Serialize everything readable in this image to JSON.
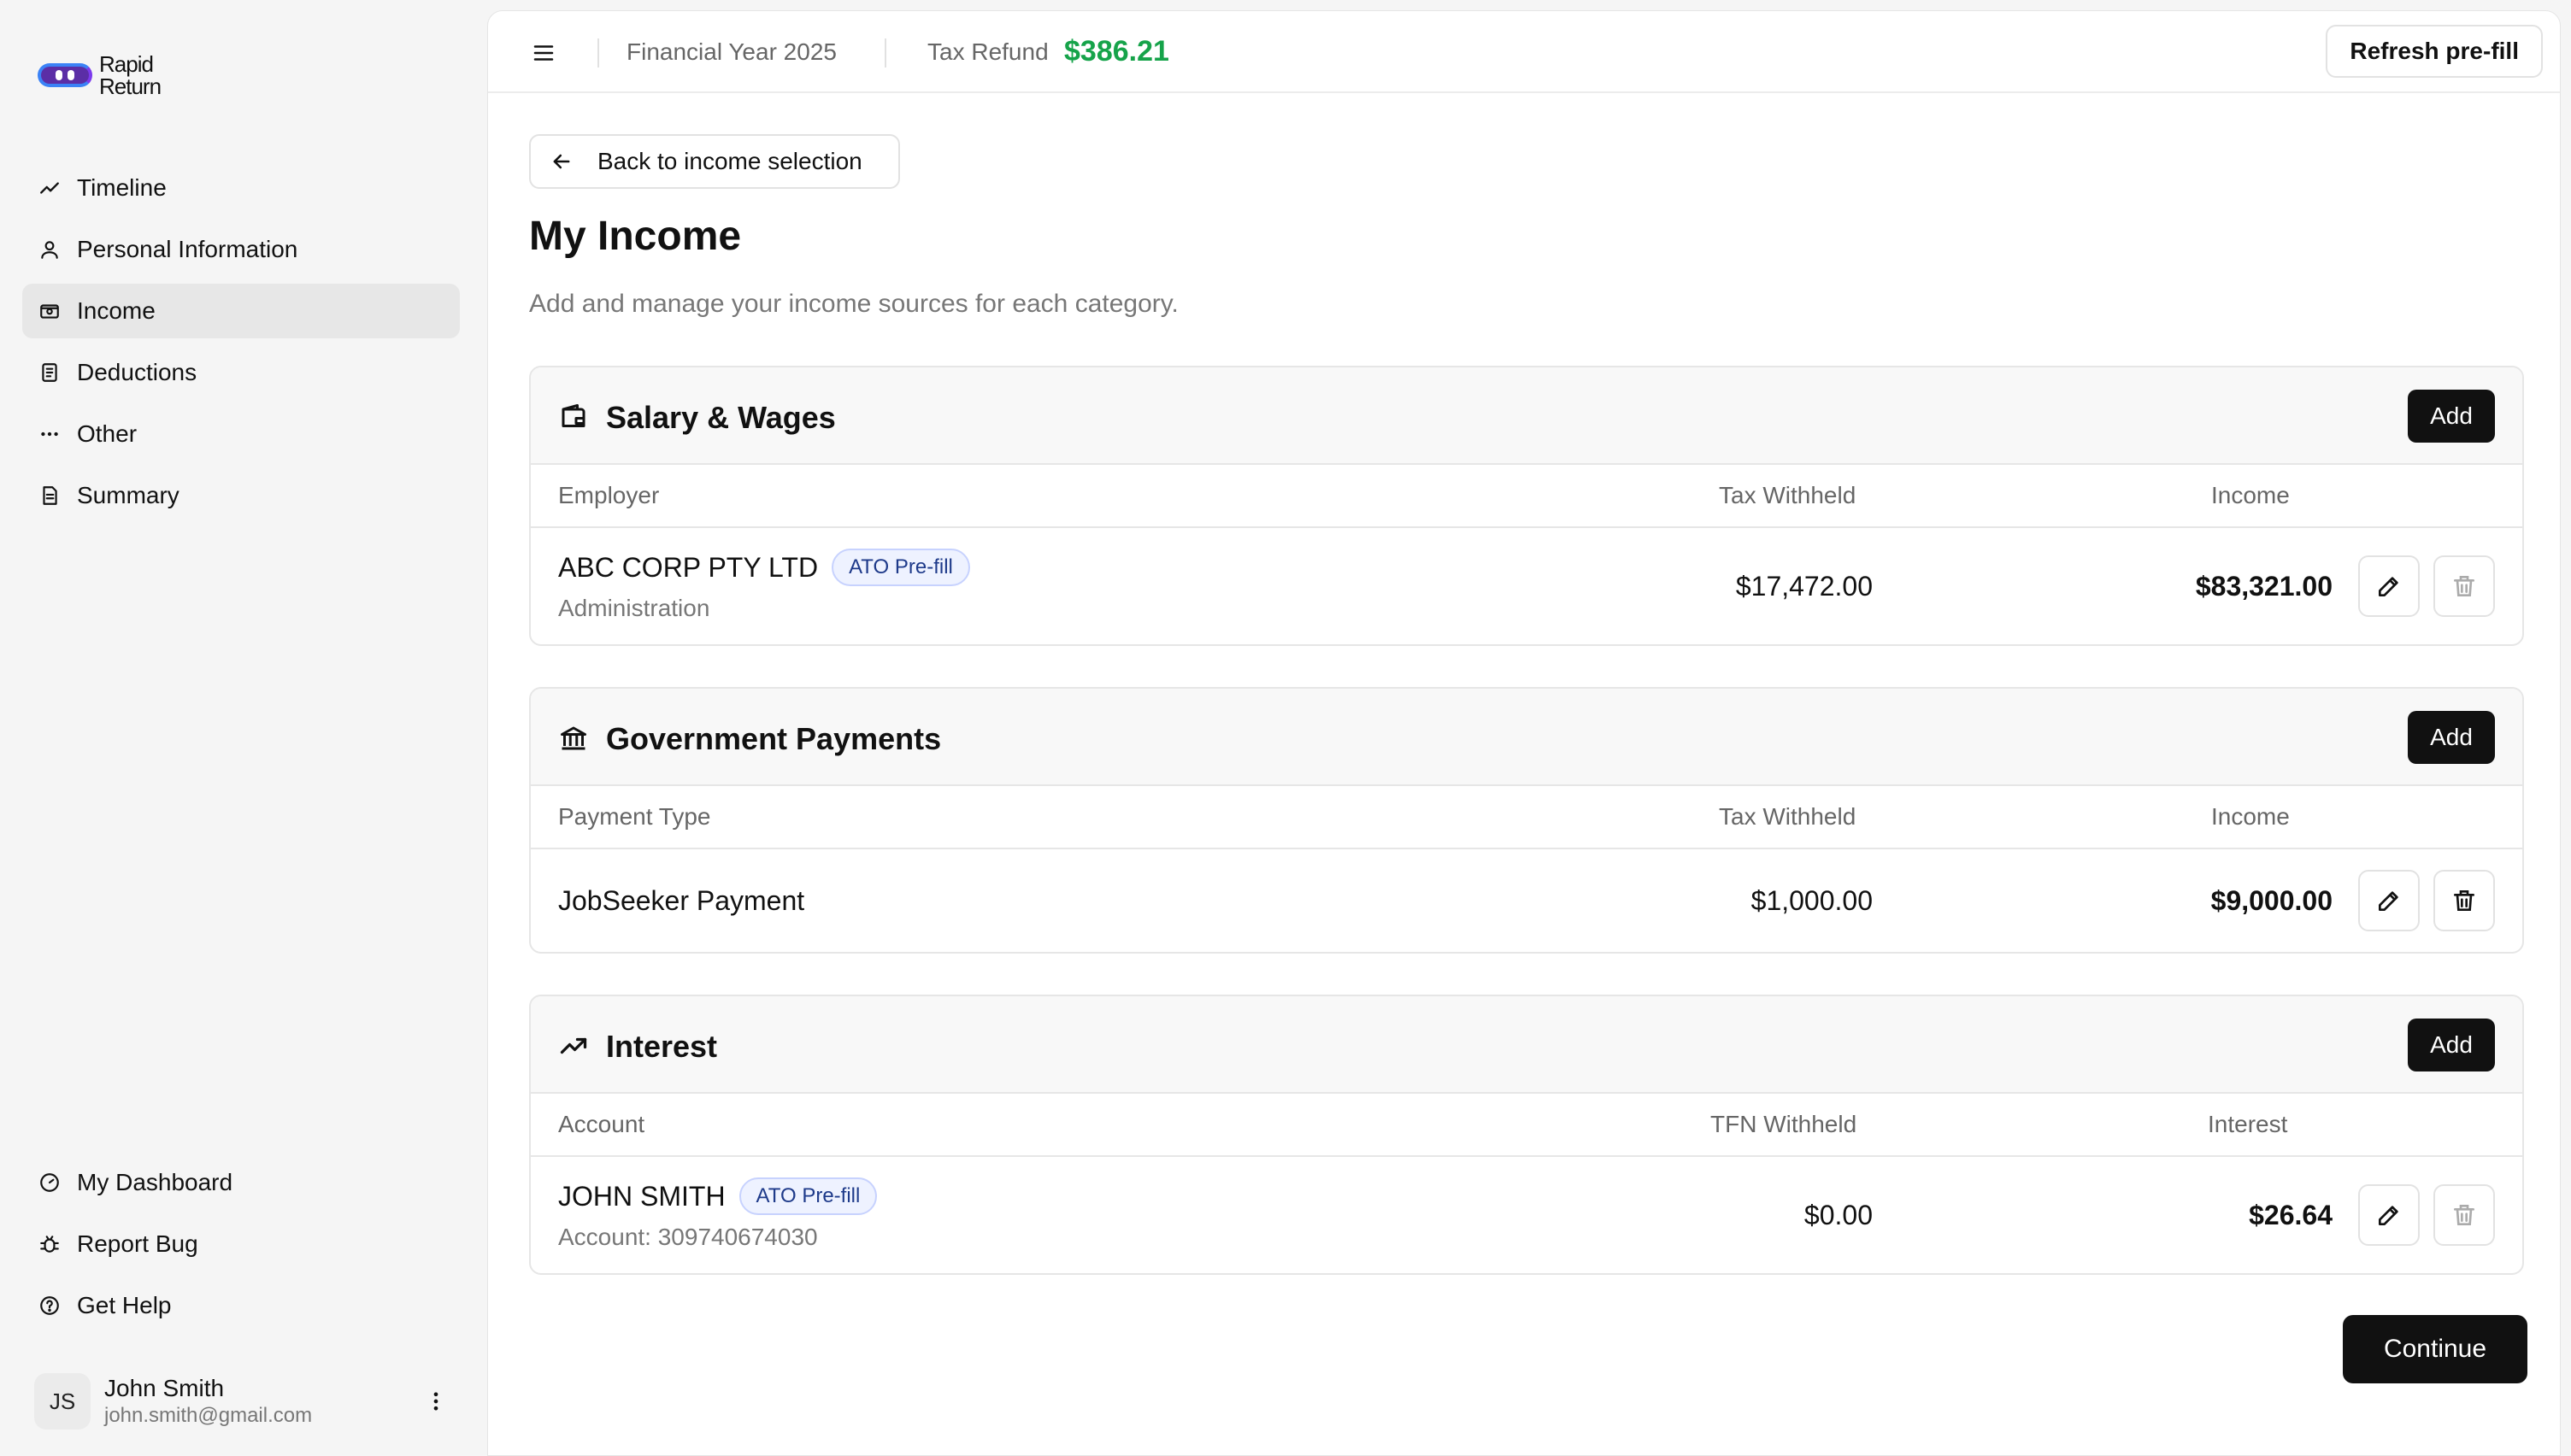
{
  "brand": {
    "line1": "Rapid",
    "line2": "Return"
  },
  "sidebar": {
    "items": [
      {
        "label": "Timeline",
        "icon": "trend-line-icon"
      },
      {
        "label": "Personal Information",
        "icon": "user-icon"
      },
      {
        "label": "Income",
        "icon": "money-icon",
        "active": true
      },
      {
        "label": "Deductions",
        "icon": "receipt-icon"
      },
      {
        "label": "Other",
        "icon": "more-horizontal-icon"
      },
      {
        "label": "Summary",
        "icon": "document-icon"
      }
    ],
    "bottom_items": [
      {
        "label": "My Dashboard",
        "icon": "gauge-icon"
      },
      {
        "label": "Report Bug",
        "icon": "bug-icon"
      },
      {
        "label": "Get Help",
        "icon": "help-circle-icon"
      }
    ],
    "user": {
      "initials": "JS",
      "name": "John Smith",
      "email": "john.smith@gmail.com"
    }
  },
  "topbar": {
    "financial_year": "Financial Year 2025",
    "tax_refund_label": "Tax Refund",
    "tax_refund_value": "$386.21",
    "refresh_label": "Refresh pre-fill"
  },
  "page": {
    "back_label": "Back to income selection",
    "title": "My Income",
    "subtitle": "Add and manage your income sources for each category."
  },
  "sections": {
    "salary": {
      "title": "Salary & Wages",
      "add_label": "Add",
      "columns": [
        "Employer",
        "Tax Withheld",
        "Income"
      ],
      "rows": [
        {
          "name": "ABC CORP PTY LTD",
          "badge": "ATO Pre-fill",
          "sub": "Administration",
          "withheld": "$17,472.00",
          "amount": "$83,321.00"
        }
      ]
    },
    "government": {
      "title": "Government Payments",
      "add_label": "Add",
      "columns": [
        "Payment Type",
        "Tax Withheld",
        "Income"
      ],
      "rows": [
        {
          "name": "JobSeeker Payment",
          "withheld": "$1,000.00",
          "amount": "$9,000.00"
        }
      ]
    },
    "interest": {
      "title": "Interest",
      "add_label": "Add",
      "columns": [
        "Account",
        "TFN Withheld",
        "Interest"
      ],
      "rows": [
        {
          "name": "JOHN SMITH",
          "badge": "ATO Pre-fill",
          "sub": "Account: 309740674030",
          "withheld": "$0.00",
          "amount": "$26.64"
        }
      ]
    }
  },
  "continue_label": "Continue",
  "colors": {
    "accent_green": "#16a34a",
    "badge_blue": "#1e3a8a",
    "button_dark": "#111111"
  }
}
